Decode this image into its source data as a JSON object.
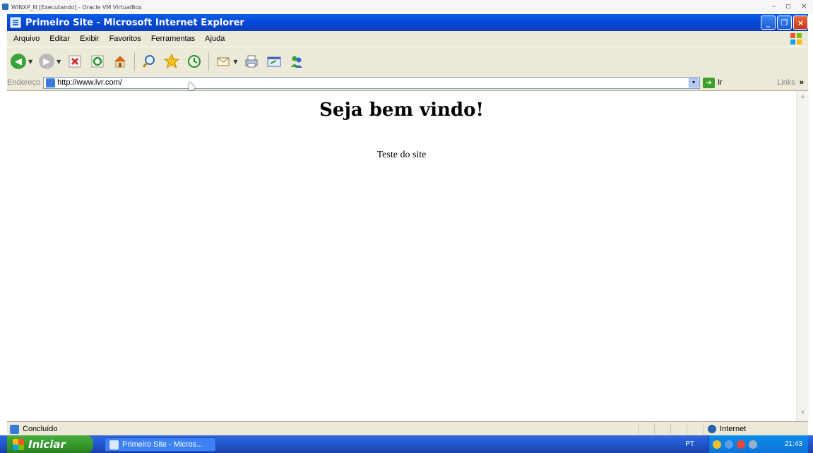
{
  "host": {
    "title": "WINXP_N [Executando] - Oracle VM VirtualBox",
    "controls": [
      "–",
      "▫",
      "×"
    ]
  },
  "window": {
    "title": "Primeiro Site - Microsoft Internet Explorer",
    "controls": [
      "_",
      "❐",
      "×"
    ]
  },
  "menu": {
    "items": [
      "Arquivo",
      "Editar",
      "Exibir",
      "Favoritos",
      "Ferramentas",
      "Ajuda"
    ]
  },
  "toolbar": {
    "buttons": [
      "back-icon",
      "forward-icon",
      "stop-icon",
      "refresh-icon",
      "home-icon",
      "search-icon",
      "favorites-icon",
      "history-icon",
      "mail-icon",
      "print-icon",
      "edit-icon",
      "messenger-icon"
    ]
  },
  "address": {
    "label": "Endereço",
    "url": "http://www.lvr.com/",
    "go_label": "Ir",
    "links_label": "Links",
    "links_more": "»"
  },
  "page": {
    "heading": "Seja bem vindo!",
    "text": "Teste do site"
  },
  "status": {
    "text": "Concluído",
    "zone": "Internet"
  },
  "taskbar": {
    "start_label": "Iniciar",
    "task_label": "Primeiro Site - Micros...",
    "language": "PT",
    "clock": "21:43"
  },
  "colors": {
    "title_blue": "#0348d6",
    "start_green": "#379a2c",
    "chrome_beige": "#ece9d8"
  }
}
